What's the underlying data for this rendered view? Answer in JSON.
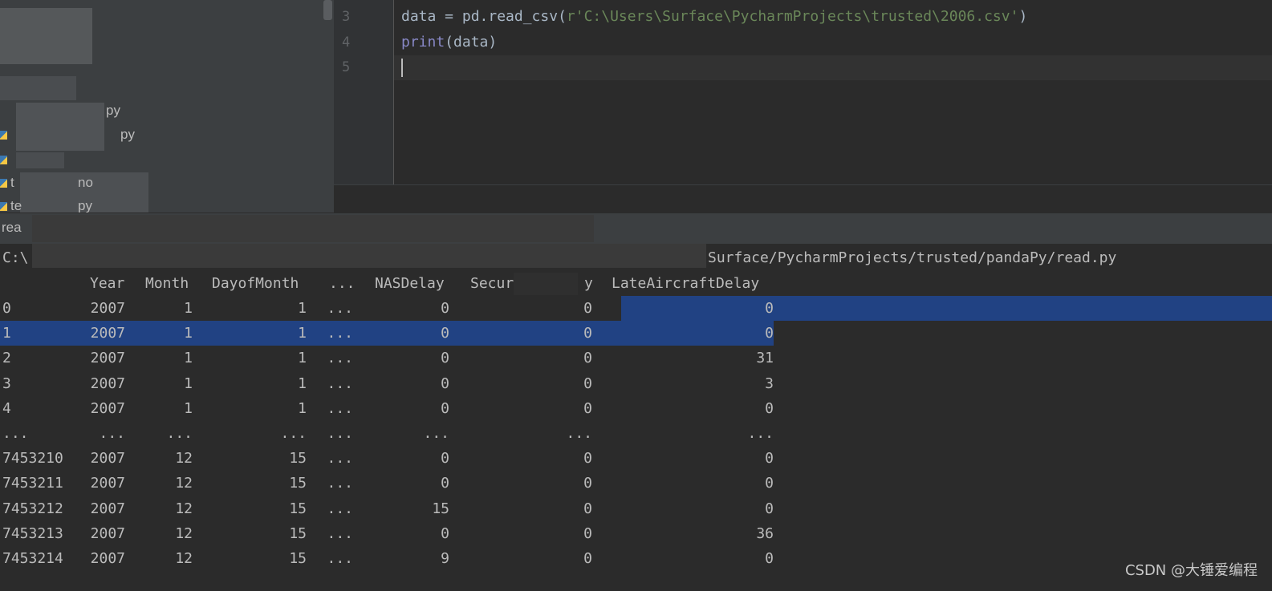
{
  "sidebar": {
    "items": [
      {
        "label": "py"
      },
      {
        "label": "py"
      },
      {
        "label": "t"
      },
      {
        "label": "no"
      },
      {
        "label": "te"
      },
      {
        "label": "py"
      }
    ]
  },
  "editor": {
    "lines": [
      {
        "num": "3",
        "code_a": "data = pd.read_csv(",
        "code_str": "r'C:\\Users\\Surface\\PycharmProjects\\trusted\\2006.csv'",
        "code_b": ")"
      },
      {
        "num": "4",
        "builtin": "print",
        "code_b": "(data)"
      },
      {
        "num": "5"
      }
    ]
  },
  "run": {
    "tab_label": "rea",
    "cmd_prefix": "C:\\",
    "cmd_path": "Surface/PycharmProjects/trusted/pandaPy/read.py"
  },
  "table": {
    "headers": [
      "Year",
      "Month",
      "DayofMonth",
      "...",
      "NASDelay",
      "SecurityDelay",
      "LateAircraftDelay"
    ],
    "header_visible": {
      "year": "Year",
      "month": "Month",
      "dayofmonth": "DayofMonth",
      "dots": "...",
      "nas": "NASDelay",
      "sec": "Secur",
      "y": "y",
      "late": "LateAircraftDelay"
    },
    "rows": [
      [
        "0",
        "2007",
        "1",
        "1",
        "...",
        "0",
        "0",
        "0"
      ],
      [
        "1",
        "2007",
        "1",
        "1",
        "...",
        "0",
        "0",
        "0"
      ],
      [
        "2",
        "2007",
        "1",
        "1",
        "...",
        "0",
        "0",
        "31"
      ],
      [
        "3",
        "2007",
        "1",
        "1",
        "...",
        "0",
        "0",
        "3"
      ],
      [
        "4",
        "2007",
        "1",
        "1",
        "...",
        "0",
        "0",
        "0"
      ],
      [
        "...",
        "...",
        "...",
        "...",
        "...",
        "...",
        "...",
        "..."
      ],
      [
        "7453210",
        "2007",
        "12",
        "15",
        "...",
        "0",
        "0",
        "0"
      ],
      [
        "7453211",
        "2007",
        "12",
        "15",
        "...",
        "0",
        "0",
        "0"
      ],
      [
        "7453212",
        "2007",
        "12",
        "15",
        "...",
        "15",
        "0",
        "0"
      ],
      [
        "7453213",
        "2007",
        "12",
        "15",
        "...",
        "0",
        "0",
        "36"
      ],
      [
        "7453214",
        "2007",
        "12",
        "15",
        "...",
        "9",
        "0",
        "0"
      ]
    ]
  },
  "watermark": "CSDN @大锤爱编程"
}
